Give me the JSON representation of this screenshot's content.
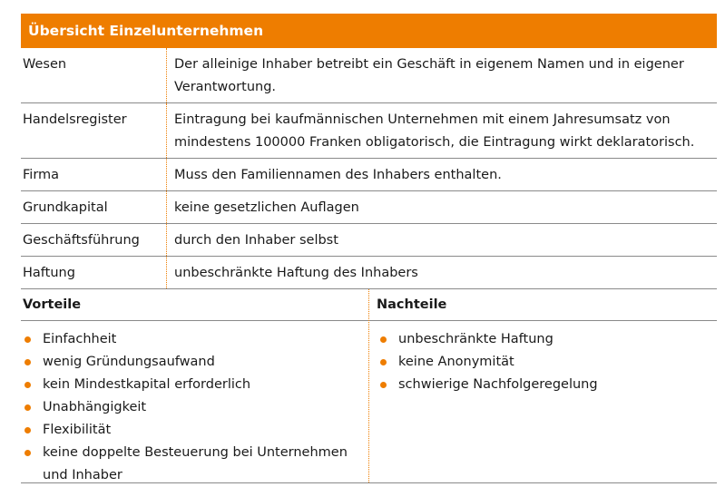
{
  "header": {
    "title": "Übersicht Einzelunternehmen"
  },
  "rows": [
    {
      "label": "Wesen",
      "value": "Der alleinige Inhaber betreibt ein Geschäft in eigenem Namen und in eigener Verantwortung."
    },
    {
      "label": "Handelsregister",
      "value": "Eintragung bei kaufmännischen Unternehmen mit einem Jahresumsatz von mindestens 100000 Franken obligatorisch, die Eintragung wirkt deklaratorisch."
    },
    {
      "label": "Firma",
      "value": "Muss den Familiennamen des Inhabers enthalten."
    },
    {
      "label": "Grundkapital",
      "value": "keine gesetzlichen Auflagen"
    },
    {
      "label": "Geschäftsführung",
      "value": "durch den Inhaber selbst"
    },
    {
      "label": "Haftung",
      "value": "unbeschränkte Haftung des Inhabers"
    }
  ],
  "vorteile": {
    "title": "Vorteile",
    "items": [
      "Einfachheit",
      "wenig Gründungsaufwand",
      "kein Mindestkapital erforderlich",
      "Unabhängigkeit",
      "Flexibilität",
      "keine doppelte Besteuerung bei Unternehmen und Inhaber"
    ]
  },
  "nachteile": {
    "title": "Nachteile",
    "items": [
      "unbeschränkte Haftung",
      "keine Anonymität",
      "schwierige Nachfolgeregelung"
    ]
  },
  "colors": {
    "accent": "#ee7d00",
    "rule": "#8a8a8a"
  }
}
